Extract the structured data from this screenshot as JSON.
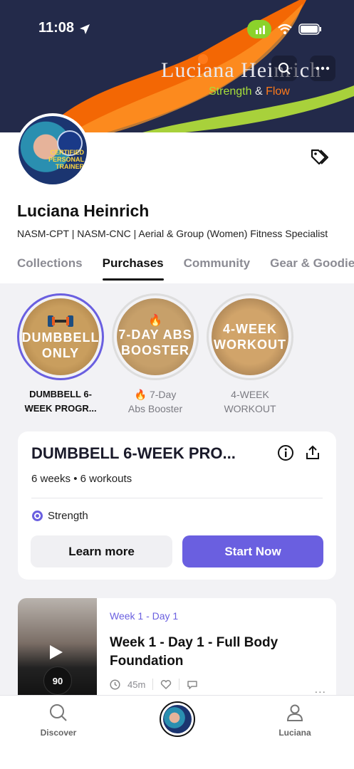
{
  "status": {
    "time": "11:08"
  },
  "banner": {
    "brand_name": "Luciana Heinrich",
    "tag_strength": "Strength",
    "tag_amp": "&",
    "tag_flow": "Flow"
  },
  "profile": {
    "name": "Luciana Heinrich",
    "bio": "NASM-CPT | NASM-CNC | Aerial & Group (Women) Fitness Specialist",
    "avatar_text_1": "CERTIFIED",
    "avatar_text_2": "PERSONAL",
    "avatar_text_3": "TRAINER"
  },
  "tabs": [
    {
      "label": "Collections"
    },
    {
      "label": "Purchases"
    },
    {
      "label": "Community"
    },
    {
      "label": "Gear & Goodies"
    }
  ],
  "collections": [
    {
      "img_line1": "DUMBBELL",
      "img_line2": "ONLY",
      "label_line1": "DUMBBELL 6-",
      "label_line2": "WEEK PROGR..."
    },
    {
      "img_line1": "7-DAY ABS",
      "img_line2": "BOOSTER",
      "label_line1": "🔥 7-Day",
      "label_line2": "Abs Booster"
    },
    {
      "img_line1": "4-WEEK",
      "img_line2": "WORKOUT",
      "label_line1": "4-WEEK",
      "label_line2": "WORKOUT"
    }
  ],
  "program": {
    "title": "DUMBBELL 6-WEEK PRO...",
    "meta": "6 weeks • 6 workouts",
    "tag": "Strength",
    "learn_label": "Learn more",
    "start_label": "Start Now"
  },
  "workout": {
    "label": "Week 1 - Day 1",
    "title": "Week 1 - Day 1 - Full Body Foundation",
    "duration": "45m",
    "hr": "90",
    "more": "..."
  },
  "nav": [
    {
      "label": "Discover"
    },
    {
      "label": "Luciana"
    }
  ],
  "colors": {
    "accent": "#6a5fe0",
    "banner": "#232a4a",
    "orange": "#ff7a1a",
    "green": "#a7de3a"
  }
}
